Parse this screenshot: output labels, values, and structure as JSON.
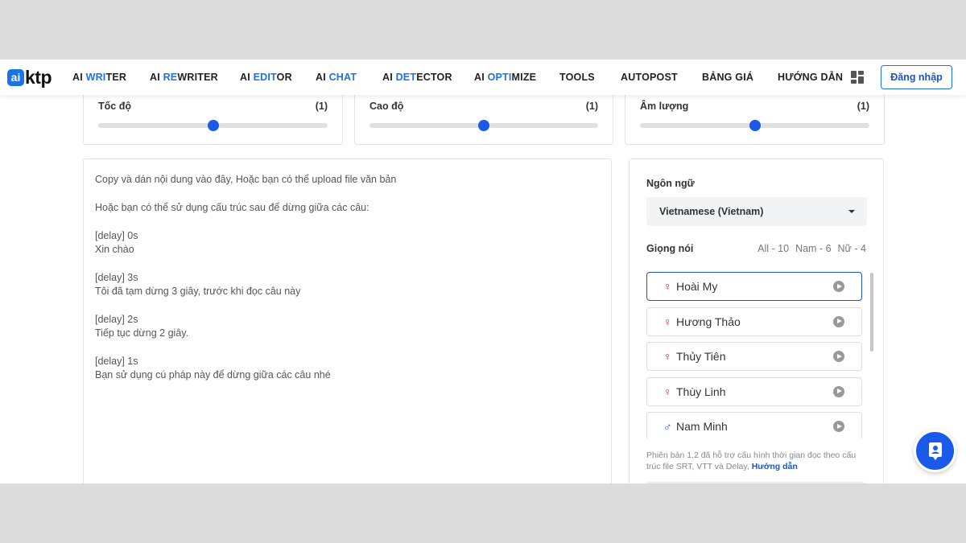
{
  "header": {
    "logo": {
      "mark": "ai",
      "text": "ktp"
    },
    "nav": [
      {
        "prefix": "AI ",
        "highlight": "WRI",
        "suffix": "TER"
      },
      {
        "prefix": "AI ",
        "highlight": "RE",
        "suffix": "WRITER"
      },
      {
        "prefix": "AI ",
        "highlight": "EDIT",
        "suffix": "OR"
      },
      {
        "prefix": "AI ",
        "highlight": "CHAT",
        "suffix": ""
      },
      {
        "prefix": "AI ",
        "highlight": "DET",
        "suffix": "ECTOR"
      },
      {
        "prefix": "AI ",
        "highlight": "OPTI",
        "suffix": "MIZE"
      },
      {
        "prefix": "TOOLS",
        "highlight": "",
        "suffix": ""
      },
      {
        "prefix": "AUTOPOST",
        "highlight": "",
        "suffix": ""
      },
      {
        "prefix": "BẢNG GIÁ",
        "highlight": "",
        "suffix": ""
      },
      {
        "prefix": "HƯỚNG DẪN",
        "highlight": "",
        "suffix": ""
      }
    ],
    "apps_icon": "grid-icon",
    "login_label": "Đăng nhập"
  },
  "sliders": [
    {
      "label": "Tốc độ",
      "value": "(1)",
      "fraction": 0.5
    },
    {
      "label": "Cao độ",
      "value": "(1)",
      "fraction": 0.5
    },
    {
      "label": "Âm lượng",
      "value": "(1)",
      "fraction": 0.5
    }
  ],
  "editor": {
    "lines": [
      "Copy và dán nội dung vào đây, Hoặc bạn có thể upload file văn bản",
      "",
      "Hoặc bạn có thể sử dụng cấu trúc sau để dừng giữa các câu:",
      "",
      "[delay] 0s",
      "Xin chào",
      "",
      "[delay] 3s",
      "Tôi đã tạm dừng 3 giây, trước khi đọc câu này",
      "",
      "[delay] 2s",
      "Tiếp tục dừng 2 giây.",
      "",
      "[delay] 1s",
      "Bạn sử dụng cú pháp này để dừng giữa các câu nhé"
    ]
  },
  "panel": {
    "language_label": "Ngôn ngữ",
    "language_value": "Vietnamese (Vietnam)",
    "voice_label": "Giọng nói",
    "counts": [
      "All - 10",
      "Nam - 6",
      "Nữ - 4"
    ],
    "voices": [
      {
        "symbol": "♀",
        "gender": "female",
        "name": "Hoài My",
        "selected": true
      },
      {
        "symbol": "♀",
        "gender": "female",
        "name": "Hương Thảo",
        "selected": false
      },
      {
        "symbol": "♀",
        "gender": "female",
        "name": "Thủy Tiên",
        "selected": false
      },
      {
        "symbol": "♀",
        "gender": "female",
        "name": "Thùy Linh",
        "selected": false
      },
      {
        "symbol": "♂",
        "gender": "male",
        "name": "Nam Minh",
        "selected": false
      }
    ],
    "note_text": "Phiên bản 1.2 đã hỗ trợ cấu hình thời gian đọc theo cấu trúc file SRT, VTT và Delay,",
    "note_link": "Hướng dẫn"
  },
  "colors": {
    "accent": "#1a73e8",
    "female": "#e0245e",
    "male": "#1a56c4"
  },
  "help_icon": "support-agent-icon"
}
